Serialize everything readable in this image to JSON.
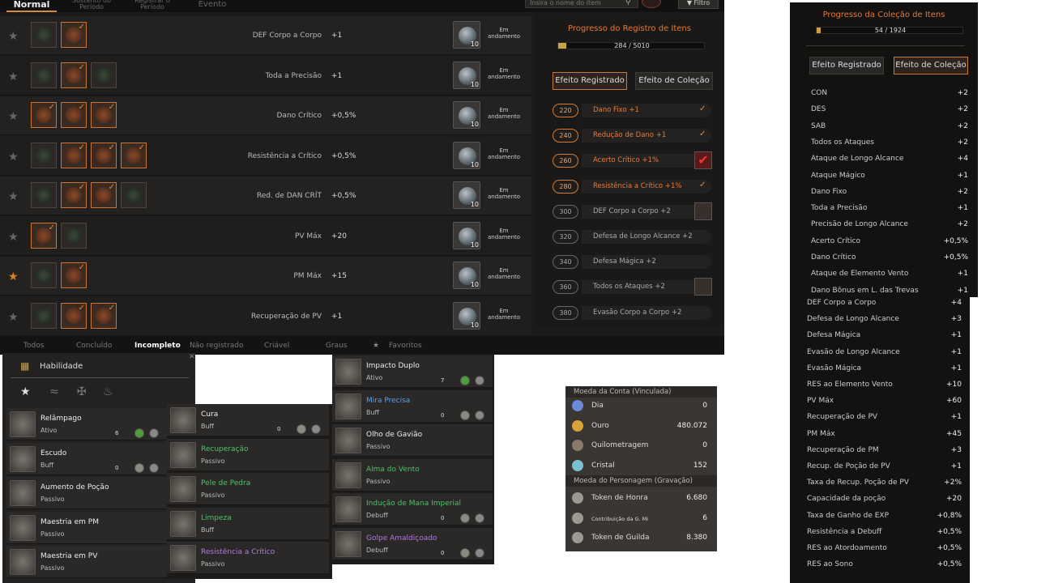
{
  "top_tabs": [
    {
      "label": "Normal"
    },
    {
      "label": "Sustento do Período"
    },
    {
      "label": "Registrar o Período"
    },
    {
      "label": "Evento"
    }
  ],
  "search": {
    "placeholder": "Insira o nome do item"
  },
  "filter_label": "Filtro",
  "rows": [
    {
      "name": "DEF Corpo a Corpo",
      "value": "+1",
      "count": "10",
      "status": "Em andamento",
      "fav": false
    },
    {
      "name": "Toda a Precisão",
      "value": "+1",
      "count": "10",
      "status": "Em andamento",
      "fav": false
    },
    {
      "name": "Dano Crítico",
      "value": "+0,5%",
      "count": "10",
      "status": "Em andamento",
      "fav": false
    },
    {
      "name": "Resistência a Crítico",
      "value": "+0,5%",
      "count": "10",
      "status": "Em andamento",
      "fav": false
    },
    {
      "name": "Red. de DAN CRÍT",
      "value": "+0,5%",
      "count": "10",
      "status": "Em andamento",
      "fav": false
    },
    {
      "name": "PV Máx",
      "value": "+20",
      "count": "10",
      "status": "Em andamento",
      "fav": false
    },
    {
      "name": "PM Máx",
      "value": "+15",
      "count": "10",
      "status": "Em andamento",
      "fav": true
    },
    {
      "name": "Recuperação de PV",
      "value": "+1",
      "count": "10",
      "status": "Em andamento",
      "fav": false
    }
  ],
  "registration": {
    "title": "Progresso do Registro de Itens",
    "progress_text": "284 / 5010",
    "progress_fraction": 0.057,
    "btn_registered": "Efeito Registrado",
    "btn_collection": "Efeito de Coleção",
    "levels": [
      {
        "lvl": "220",
        "effect": "Dano Fixo +1",
        "done": true
      },
      {
        "lvl": "240",
        "effect": "Redução de Dano +1",
        "done": true
      },
      {
        "lvl": "260",
        "effect": "Acerto Crítico +1%",
        "done": true
      },
      {
        "lvl": "280",
        "effect": "Resistência a Crítico +1%",
        "done": true
      },
      {
        "lvl": "300",
        "effect": "DEF Corpo a Corpo +2",
        "done": false
      },
      {
        "lvl": "320",
        "effect": "Defesa de Longo Alcance +2",
        "done": false
      },
      {
        "lvl": "340",
        "effect": "Defesa Mágica +2",
        "done": false
      },
      {
        "lvl": "360",
        "effect": "Todos os Ataques +2",
        "done": false
      },
      {
        "lvl": "380",
        "effect": "Evasão Corpo a Corpo +2",
        "done": false
      }
    ]
  },
  "bottom_tabs": [
    {
      "label": "Todos"
    },
    {
      "label": "Concluído"
    },
    {
      "label": "Incompleto"
    },
    {
      "label": "Não registrado"
    },
    {
      "label": "Criável"
    },
    {
      "label": "Graus"
    },
    {
      "label": "Favoritos"
    }
  ],
  "skills_title": "Habilidade",
  "skills_col1": [
    {
      "name": "Relâmpago",
      "type": "Ativo",
      "level": "6"
    },
    {
      "name": "Escudo",
      "type": "Buff",
      "level": "0"
    },
    {
      "name": "Aumento de Poção",
      "type": "Passivo"
    },
    {
      "name": "Maestria em PM",
      "type": "Passivo"
    },
    {
      "name": "Maestria em PV",
      "type": "Passivo"
    }
  ],
  "skills_col2": [
    {
      "name": "Cura",
      "type": "Buff",
      "level": "0"
    },
    {
      "name": "Recuperação",
      "type": "Passivo"
    },
    {
      "name": "Pele de Pedra",
      "type": "Passivo"
    },
    {
      "name": "Limpeza",
      "type": "Buff"
    },
    {
      "name": "Resistência a Crítico",
      "type": "Passivo"
    }
  ],
  "skills_col3": [
    {
      "name": "Impacto Duplo",
      "type": "Ativo",
      "level": "7"
    },
    {
      "name": "Mira Precisa",
      "type": "Buff",
      "level": "0"
    },
    {
      "name": "Olho de Gavião",
      "type": "Passivo"
    },
    {
      "name": "Alma do Vento",
      "type": "Passivo"
    },
    {
      "name": "Indução de Mana Imperial",
      "type": "Debuff",
      "level": "0"
    },
    {
      "name": "Golpe Amaldiçoado",
      "type": "Debuff",
      "level": "0"
    }
  ],
  "currency": {
    "header1": "Moeda da Conta (Vinculada)",
    "header2": "Moeda do Personagem (Gravação)",
    "items1": [
      {
        "name": "Dia",
        "value": "0"
      },
      {
        "name": "Ouro",
        "value": "480.072"
      },
      {
        "name": "Quilometragem",
        "value": "0"
      },
      {
        "name": "Cristal",
        "value": "152"
      }
    ],
    "items2": [
      {
        "name": "Token de Honra",
        "value": "6.680"
      },
      {
        "name": "Contribuição da G. Mi",
        "value": "6"
      },
      {
        "name": "Token de Guilda",
        "value": "8.380"
      }
    ]
  },
  "collection": {
    "title": "Progresso da Coleção de Itens",
    "progress_text": "54 / 1924",
    "progress_fraction": 0.028,
    "btn_registered": "Efeito Registrado",
    "btn_collection": "Efeito de Coleção",
    "stats": [
      {
        "name": "CON",
        "value": "+2"
      },
      {
        "name": "DES",
        "value": "+2"
      },
      {
        "name": "SAB",
        "value": "+2"
      },
      {
        "name": "Todos os Ataques",
        "value": "+2"
      },
      {
        "name": "Ataque de Longo Alcance",
        "value": "+4"
      },
      {
        "name": "Ataque Mágico",
        "value": "+1"
      },
      {
        "name": "Dano Fixo",
        "value": "+2"
      },
      {
        "name": "Toda a Precisão",
        "value": "+1"
      },
      {
        "name": "Precisão de Longo Alcance",
        "value": "+2"
      },
      {
        "name": "Acerto Crítico",
        "value": "+0,5%"
      },
      {
        "name": "Dano Crítico",
        "value": "+0,5%"
      },
      {
        "name": "Ataque de Elemento Vento",
        "value": "+1"
      },
      {
        "name": "Dano Bônus em L. das Trevas",
        "value": "+1"
      }
    ],
    "stats2": [
      {
        "name": "DEF Corpo a Corpo",
        "value": "+4"
      },
      {
        "name": "Defesa de Longo Alcance",
        "value": "+3"
      },
      {
        "name": "Defesa Mágica",
        "value": "+1"
      },
      {
        "name": "Evasão de Longo Alcance",
        "value": "+1"
      },
      {
        "name": "Evasão Mágica",
        "value": "+1"
      },
      {
        "name": "RES ao Elemento Vento",
        "value": "+10"
      },
      {
        "name": "PV Máx",
        "value": "+60"
      },
      {
        "name": "Recuperação de PV",
        "value": "+1"
      },
      {
        "name": "PM Máx",
        "value": "+45"
      },
      {
        "name": "Recuperação de PM",
        "value": "+3"
      },
      {
        "name": "Recup. de Poção de PV",
        "value": "+1"
      },
      {
        "name": "Taxa de Recup. Poção de PV",
        "value": "+2%"
      },
      {
        "name": "Capacidade da poção",
        "value": "+20"
      },
      {
        "name": "Taxa de Ganho de EXP",
        "value": "+0,8%"
      },
      {
        "name": "Resistência a Debuff",
        "value": "+0,5%"
      },
      {
        "name": "RES ao Atordoamento",
        "value": "+0,5%"
      },
      {
        "name": "RES ao Sono",
        "value": "+0,5%"
      }
    ]
  }
}
